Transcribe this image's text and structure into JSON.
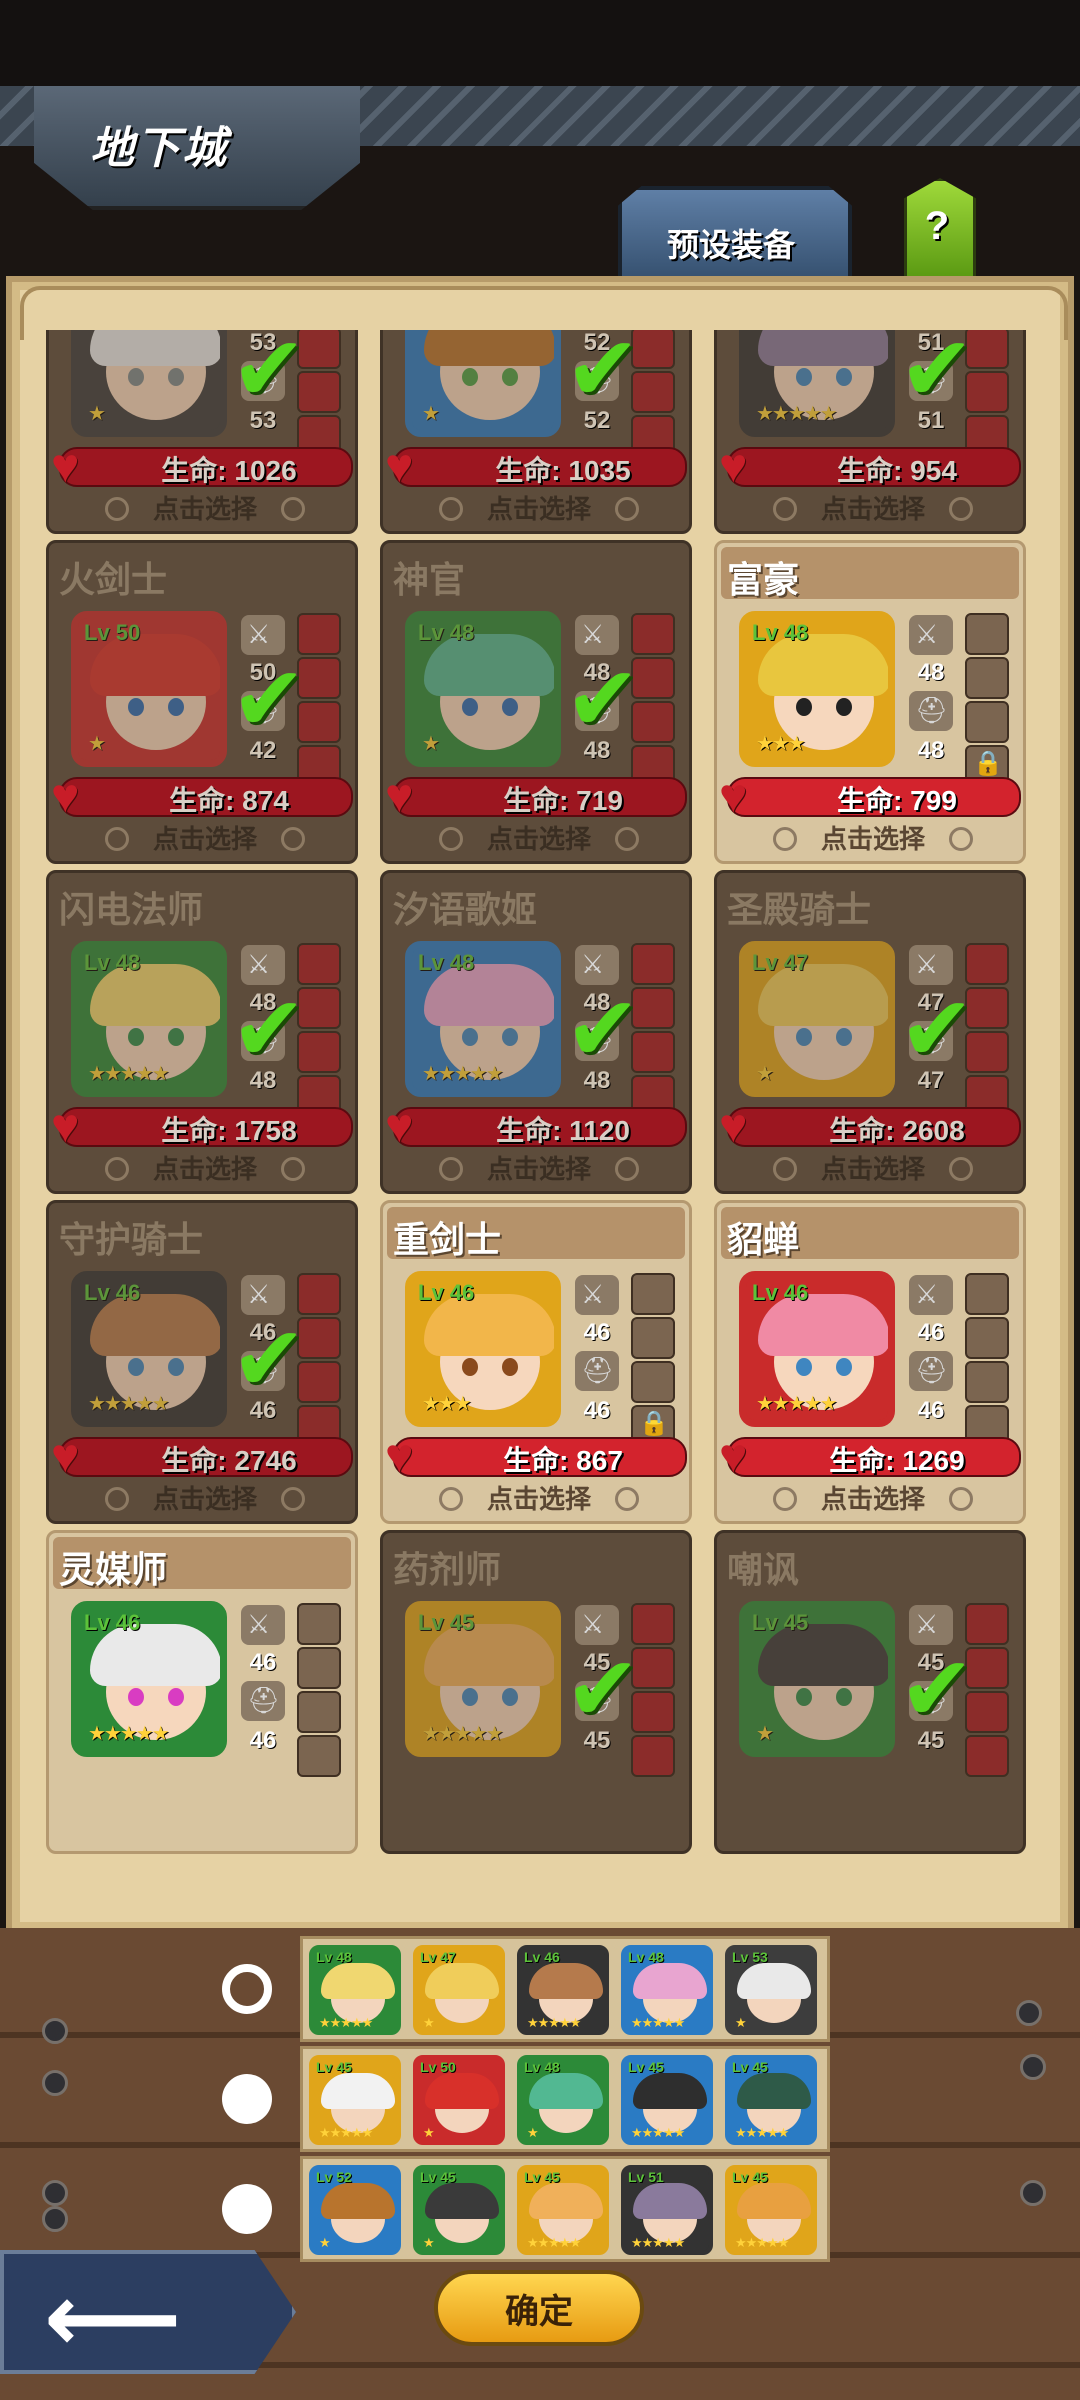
{
  "header": {
    "title": "地下城",
    "preset_label": "预设装备",
    "help_label": "?"
  },
  "select_label": "点击选择",
  "hp_prefix": "生命:",
  "check_icon": "checkmark-icon",
  "colors": {
    "hp_bar": "#d3232d",
    "check": "#54d81f",
    "confirm": "#f2b52a",
    "level": "#5cc23a"
  },
  "heroes": [
    {
      "name": "",
      "level": "Lv 53",
      "w": "53",
      "a": "53",
      "hp": "生命: 1026",
      "selected": true,
      "stars": "★",
      "frame": "#3d3d3d",
      "hair": "#e9e9e9",
      "eye": "#7e8a8c"
    },
    {
      "name": "",
      "level": "Lv 52",
      "w": "52",
      "a": "52",
      "hp": "生命: 1035",
      "selected": true,
      "stars": "★",
      "frame": "#2a7bc4",
      "hair": "#b8742d",
      "eye": "#4da046"
    },
    {
      "name": "",
      "level": "Lv 51",
      "w": "51",
      "a": "51",
      "hp": "生命: 954",
      "selected": true,
      "stars": "★★★★★",
      "frame": "#333333",
      "hair": "#8a7a9c",
      "eye": "#3f86c0"
    },
    {
      "name": "火剑士",
      "level": "Lv 50",
      "w": "50",
      "a": "42",
      "hp": "生命: 874",
      "selected": true,
      "stars": "★",
      "frame": "#c92b2b",
      "hair": "#d8302a",
      "eye": "#2c6bb4"
    },
    {
      "name": "神官",
      "level": "Lv 48",
      "w": "48",
      "a": "48",
      "hp": "生命: 719",
      "selected": true,
      "stars": "★",
      "frame": "#2c8a38",
      "hair": "#52b892",
      "eye": "#2c6bb4"
    },
    {
      "name": "富豪",
      "level": "Lv 48",
      "w": "48",
      "a": "48",
      "hp": "生命: 799",
      "selected": false,
      "stars": "★★★",
      "frame": "#e0a51a",
      "hair": "#e8c63e",
      "eye": "#222222"
    },
    {
      "name": "闪电法师",
      "level": "Lv 48",
      "w": "48",
      "a": "48",
      "hp": "生命: 1758",
      "selected": true,
      "stars": "★★★★★",
      "frame": "#2c8a38",
      "hair": "#f0d770",
      "eye": "#2f8c4a"
    },
    {
      "name": "汐语歌姬",
      "level": "Lv 48",
      "w": "48",
      "a": "48",
      "hp": "生命: 1120",
      "selected": true,
      "stars": "★★★★★",
      "frame": "#2a7bc4",
      "hair": "#e8a5d0",
      "eye": "#3f86c0"
    },
    {
      "name": "圣殿骑士",
      "level": "Lv 47",
      "w": "47",
      "a": "47",
      "hp": "生命: 2608",
      "selected": true,
      "stars": "★",
      "frame": "#e0a51a",
      "hair": "#f0cd5a",
      "eye": "#3f86c0"
    },
    {
      "name": "守护骑士",
      "level": "Lv 46",
      "w": "46",
      "a": "46",
      "hp": "生命: 2746",
      "selected": true,
      "stars": "★★★★★",
      "frame": "#333333",
      "hair": "#b57a4c",
      "eye": "#3f86c0"
    },
    {
      "name": "重剑士",
      "level": "Lv 46",
      "w": "46",
      "a": "46",
      "hp": "生命: 867",
      "selected": false,
      "stars": "★★★",
      "frame": "#e0a51a",
      "hair": "#f2b64a",
      "eye": "#8a4a1c"
    },
    {
      "name": "貂蝉",
      "level": "Lv 46",
      "w": "46",
      "a": "46",
      "hp": "生命: 1269",
      "selected": false,
      "stars": "★★★★★",
      "frame": "#c92b2b",
      "hair": "#f08aa4",
      "eye": "#3f86c0"
    },
    {
      "name": "灵媒师",
      "level": "Lv 46",
      "w": "46",
      "a": "46",
      "hp": "",
      "selected": false,
      "stars": "★★★★★",
      "frame": "#2c8a38",
      "hair": "#e9e9e9",
      "eye": "#d93cc2"
    },
    {
      "name": "药剂师",
      "level": "Lv 45",
      "w": "45",
      "a": "45",
      "hp": "",
      "selected": true,
      "stars": "★★★★★",
      "frame": "#e0a51a",
      "hair": "#f0b05a",
      "eye": "#3f86c0"
    },
    {
      "name": "嘲讽",
      "level": "Lv 45",
      "w": "45",
      "a": "45",
      "hp": "",
      "selected": true,
      "stars": "★",
      "frame": "#2c8a38",
      "hair": "#3a3a3a",
      "eye": "#2f8c4a"
    }
  ],
  "teams": [
    {
      "active": true,
      "members": [
        {
          "level": "Lv 48",
          "stars": "★★★★★",
          "frame": "#2c8a38",
          "hair": "#f0d770"
        },
        {
          "level": "Lv 47",
          "stars": "★",
          "frame": "#e0a51a",
          "hair": "#f0cd5a"
        },
        {
          "level": "Lv 46",
          "stars": "★★★★★",
          "frame": "#333333",
          "hair": "#b57a4c"
        },
        {
          "level": "Lv 48",
          "stars": "★★★★★",
          "frame": "#2a7bc4",
          "hair": "#e8a5d0"
        },
        {
          "level": "Lv 53",
          "stars": "★",
          "frame": "#3d3d3d",
          "hair": "#e9e9e9"
        }
      ]
    },
    {
      "active": false,
      "members": [
        {
          "level": "Lv 45",
          "stars": "★★★★★",
          "frame": "#e0a51a",
          "hair": "#f2f2f2"
        },
        {
          "level": "Lv 50",
          "stars": "★",
          "frame": "#c92b2b",
          "hair": "#d8302a"
        },
        {
          "level": "Lv 48",
          "stars": "★",
          "frame": "#2c8a38",
          "hair": "#52b892"
        },
        {
          "level": "Lv 45",
          "stars": "★★★★★",
          "frame": "#2a7bc4",
          "hair": "#2e2e2e"
        },
        {
          "level": "Lv 45",
          "stars": "★★★★★",
          "frame": "#2a7bc4",
          "hair": "#2e5a48"
        }
      ]
    },
    {
      "active": false,
      "members": [
        {
          "level": "Lv 52",
          "stars": "★",
          "frame": "#2a7bc4",
          "hair": "#b8742d"
        },
        {
          "level": "Lv 45",
          "stars": "★",
          "frame": "#2c8a38",
          "hair": "#3a3a3a"
        },
        {
          "level": "Lv 45",
          "stars": "★★★★★",
          "frame": "#e0a51a",
          "hair": "#f0b05a"
        },
        {
          "level": "Lv 51",
          "stars": "★★★★★",
          "frame": "#333333",
          "hair": "#8a7a9c"
        },
        {
          "level": "Lv 45",
          "stars": "★★★★★",
          "frame": "#e0a51a",
          "hair": "#e8a040"
        }
      ]
    }
  ],
  "confirm_label": "确定",
  "back_icon": "back-arrow-icon"
}
